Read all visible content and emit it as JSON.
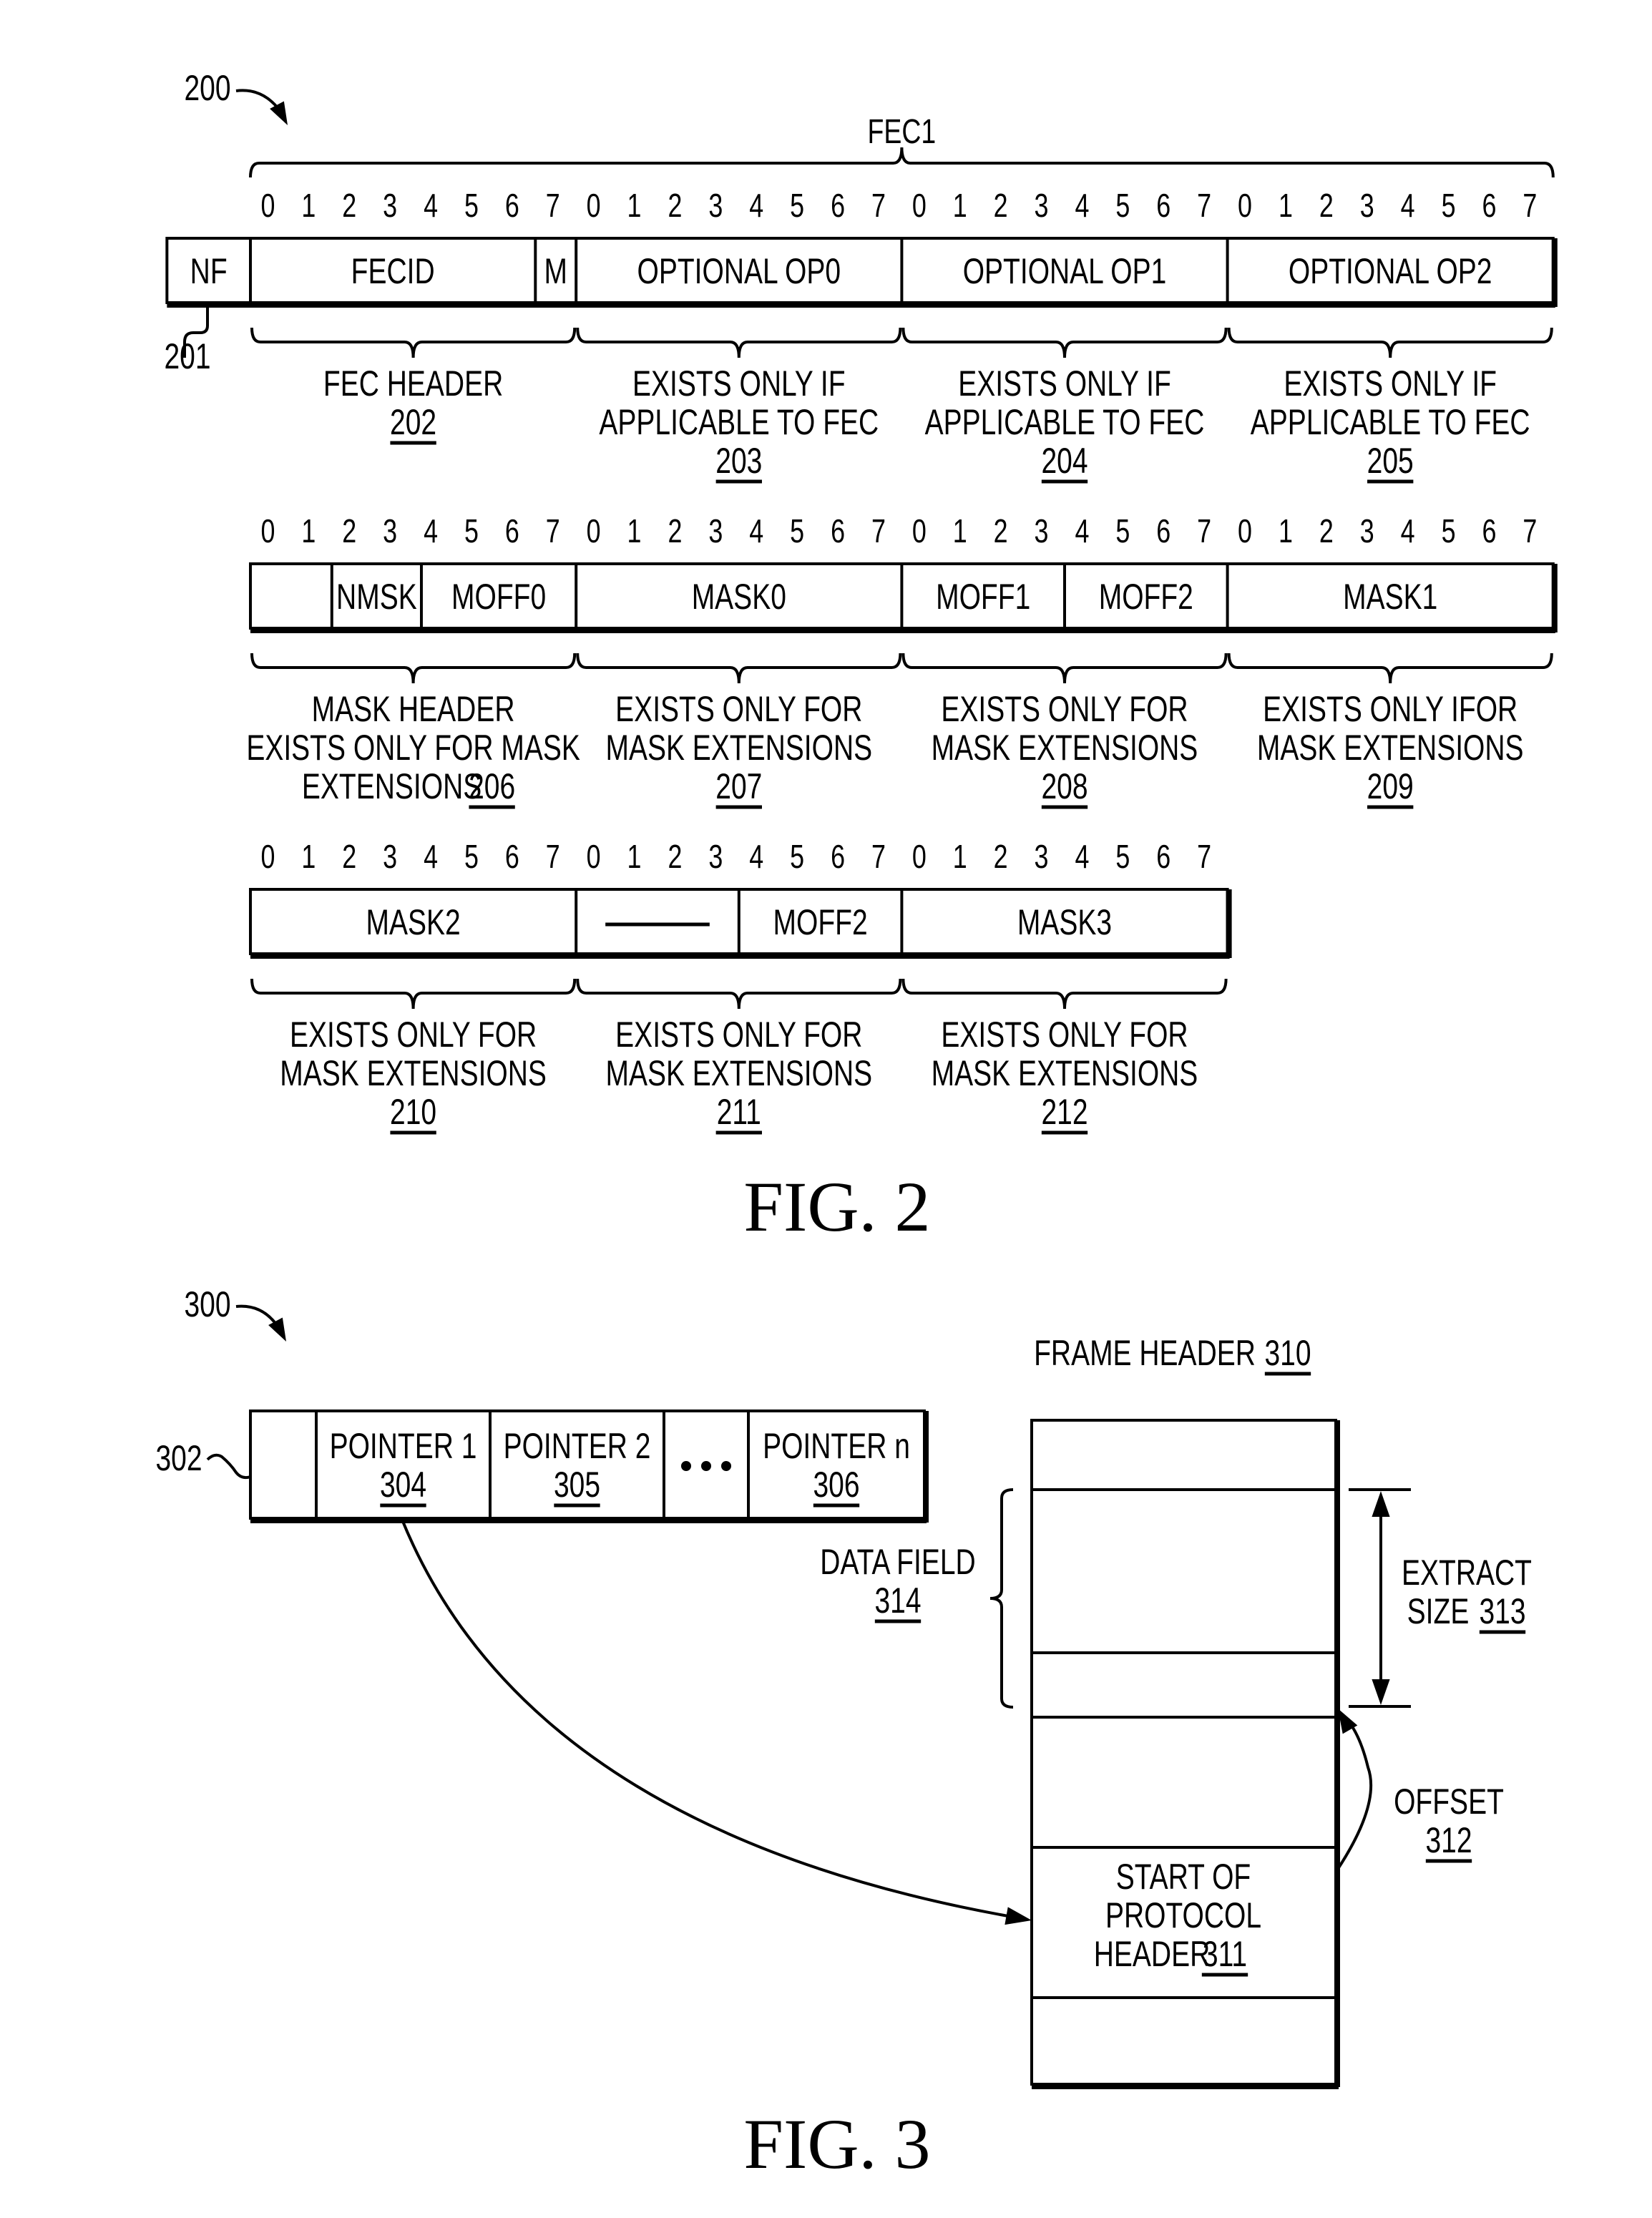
{
  "fig2": {
    "ref_label": "200",
    "nf_ref_label": "201",
    "caption": "FIG. 2",
    "top_brace_label": "FEC1",
    "bit_labels": [
      "0",
      "1",
      "2",
      "3",
      "4",
      "5",
      "6",
      "7"
    ],
    "rows": [
      {
        "fields": [
          {
            "label": "NF",
            "bits": "nf"
          },
          {
            "label": "FECID"
          },
          {
            "label": "M"
          },
          {
            "label": "OPTIONAL OP0"
          },
          {
            "label": "OPTIONAL OP1"
          },
          {
            "label": "OPTIONAL OP2"
          }
        ],
        "groups": [
          {
            "lines": [
              "FEC HEADER"
            ],
            "ref": "202"
          },
          {
            "lines": [
              "EXISTS ONLY IF",
              "APPLICABLE TO FEC"
            ],
            "ref": "203"
          },
          {
            "lines": [
              "EXISTS ONLY IF",
              "APPLICABLE TO FEC"
            ],
            "ref": "204"
          },
          {
            "lines": [
              "EXISTS ONLY IF",
              "APPLICABLE TO FEC"
            ],
            "ref": "205"
          }
        ]
      },
      {
        "fields": [
          {
            "label": ""
          },
          {
            "label": "NMSK"
          },
          {
            "label": "MOFF0"
          },
          {
            "label": "MASK0"
          },
          {
            "label": "MOFF1"
          },
          {
            "label": "MOFF2"
          },
          {
            "label": "MASK1"
          }
        ],
        "groups": [
          {
            "lines": [
              "MASK HEADER",
              "EXISTS ONLY FOR MASK",
              "EXTENSIONS"
            ],
            "ref": "206",
            "ref_inline": true
          },
          {
            "lines": [
              "EXISTS ONLY FOR",
              "MASK EXTENSIONS"
            ],
            "ref": "207"
          },
          {
            "lines": [
              "EXISTS ONLY FOR",
              "MASK EXTENSIONS"
            ],
            "ref": "208"
          },
          {
            "lines": [
              "EXISTS ONLY IFOR",
              "MASK EXTENSIONS"
            ],
            "ref": "209"
          }
        ]
      },
      {
        "fields": [
          {
            "label": "MASK2"
          },
          {
            "label": "—"
          },
          {
            "label": "MOFF2"
          },
          {
            "label": "MASK3"
          }
        ],
        "groups": [
          {
            "lines": [
              "EXISTS ONLY FOR",
              "MASK EXTENSIONS"
            ],
            "ref": "210"
          },
          {
            "lines": [
              "EXISTS ONLY FOR",
              "MASK EXTENSIONS"
            ],
            "ref": "211"
          },
          {
            "lines": [
              "EXISTS ONLY FOR",
              "MASK EXTENSIONS"
            ],
            "ref": "212"
          }
        ]
      }
    ]
  },
  "fig3": {
    "ref_label": "300",
    "pointer_table_ref": "302",
    "caption": "FIG. 3",
    "pointers": [
      {
        "label": "POINTER 1",
        "ref": "304"
      },
      {
        "label": "POINTER 2",
        "ref": "305"
      },
      {
        "label": "…",
        "ellipsis": true
      },
      {
        "label": "POINTER n",
        "ref": "306"
      }
    ],
    "frame_header": {
      "label": "FRAME HEADER",
      "ref": "310"
    },
    "start_of_protocol_header": {
      "lines": [
        "START OF",
        "PROTOCOL",
        "HEADER"
      ],
      "ref": "311"
    },
    "offset": {
      "label": "OFFSET",
      "ref": "312"
    },
    "extract_size": {
      "lines": [
        "EXTRACT",
        "SIZE"
      ],
      "ref": "313"
    },
    "data_field": {
      "label": "DATA FIELD",
      "ref": "314"
    }
  }
}
